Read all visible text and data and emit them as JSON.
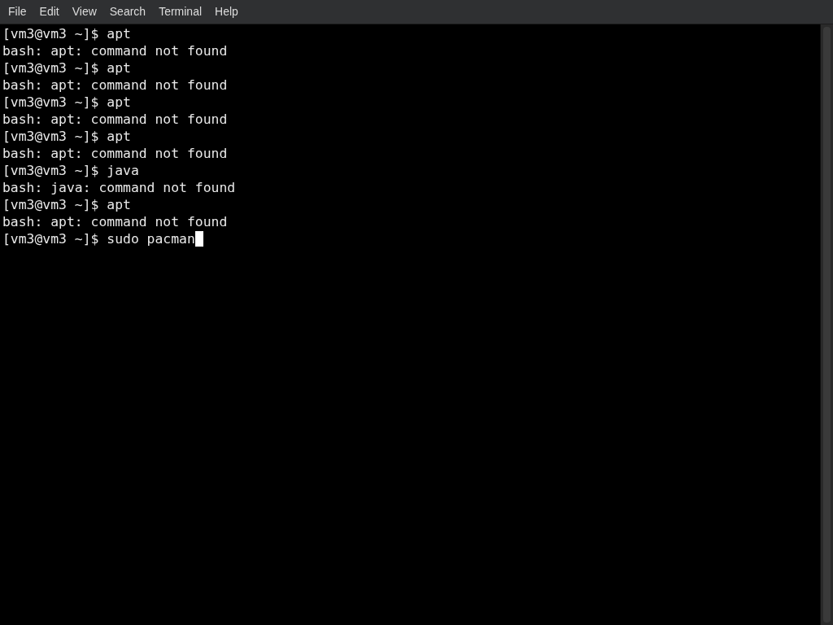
{
  "menu": [
    "File",
    "Edit",
    "View",
    "Search",
    "Terminal",
    "Help"
  ],
  "terminal": {
    "lines": [
      "[vm3@vm3 ~]$ apt",
      "bash: apt: command not found",
      "[vm3@vm3 ~]$ apt",
      "bash: apt: command not found",
      "[vm3@vm3 ~]$ apt",
      "bash: apt: command not found",
      "[vm3@vm3 ~]$ apt",
      "bash: apt: command not found",
      "[vm3@vm3 ~]$ java",
      "bash: java: command not found",
      "[vm3@vm3 ~]$ apt",
      "bash: apt: command not found"
    ],
    "input_line": "[vm3@vm3 ~]$ sudo pacman",
    "cursor_visible": true
  }
}
